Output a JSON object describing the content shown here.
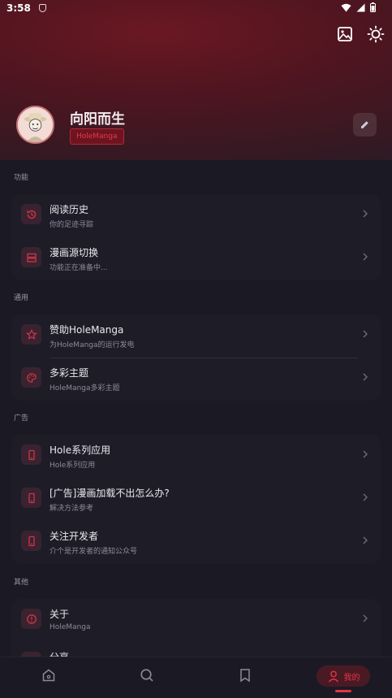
{
  "status_bar": {
    "time": "3:58"
  },
  "profile": {
    "name": "向阳而生",
    "badge": "HoleManga"
  },
  "header_icons": [
    "image-icon",
    "brightness-icon"
  ],
  "sections": [
    {
      "label": "功能",
      "items": [
        {
          "title": "阅读历史",
          "subtitle": "你的足迹寻踪",
          "icon": "history-icon"
        },
        {
          "title": "漫画源切换",
          "subtitle": "功能正在准备中...",
          "icon": "source-switch-icon"
        }
      ]
    },
    {
      "label": "通用",
      "items": [
        {
          "title": "赞助HoleManga",
          "subtitle": "为HoleManga的运行发电",
          "icon": "star-icon"
        },
        {
          "title": "多彩主题",
          "subtitle": "HoleManga多彩主题",
          "icon": "palette-icon"
        }
      ]
    },
    {
      "label": "广告",
      "items": [
        {
          "title": "Hole系列应用",
          "subtitle": "Hole系列应用",
          "icon": "phone-icon"
        },
        {
          "title": "[广告]漫画加载不出怎么办?",
          "subtitle": "解决方法参考",
          "icon": "phone-icon"
        },
        {
          "title": "关注开发者",
          "subtitle": "介个是开发者的通知公众号",
          "icon": "phone-icon"
        }
      ]
    },
    {
      "label": "其他",
      "items": [
        {
          "title": "关于",
          "subtitle": "HoleManga",
          "icon": "info-icon"
        },
        {
          "title": "分享",
          "subtitle": "",
          "icon": "share-icon"
        }
      ]
    }
  ],
  "bottom_nav": {
    "active_label": "我的",
    "items": [
      "home-icon",
      "search-icon",
      "bookmark-icon",
      "profile-icon"
    ]
  },
  "colors": {
    "accent": "#e23447",
    "background": "#1b1a24",
    "card": "#1e1d27"
  }
}
